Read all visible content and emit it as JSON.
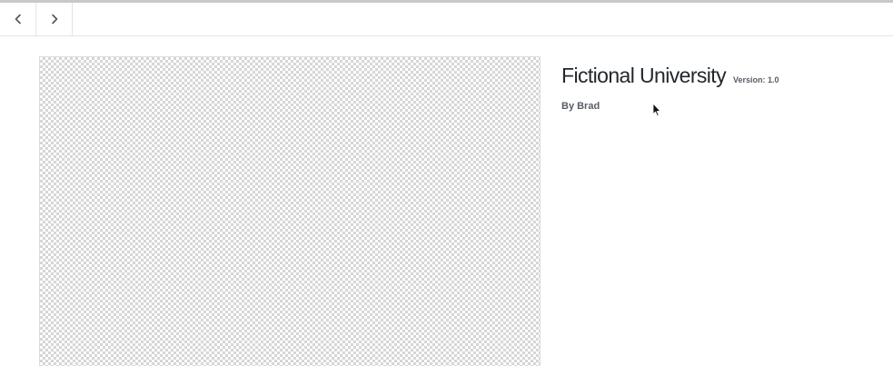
{
  "nav": {
    "prev_icon": "chevron-left-icon",
    "next_icon": "chevron-right-icon"
  },
  "theme": {
    "name": "Fictional University",
    "version": "Version: 1.0",
    "author": "By Brad"
  },
  "colors": {
    "title": "#23282d",
    "meta": "#555d66",
    "border": "#e2e4e7",
    "checker": "#d6d6d6"
  }
}
